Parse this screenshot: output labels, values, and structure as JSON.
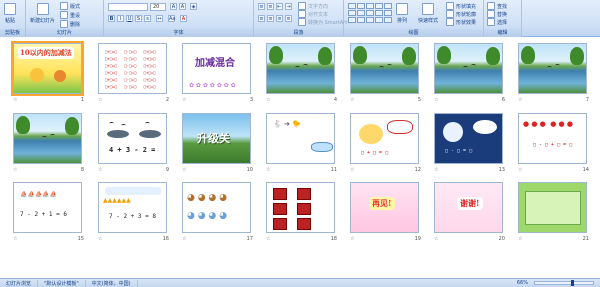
{
  "ribbon": {
    "groups": [
      {
        "id": "clipboard",
        "label": "剪贴板",
        "buttons": [
          "粘贴"
        ]
      },
      {
        "id": "slides",
        "label": "幻灯片",
        "buttons": [
          "新建幻灯片",
          "版式",
          "重设",
          "删除"
        ]
      },
      {
        "id": "font",
        "label": "字体",
        "font_size": "20"
      },
      {
        "id": "paragraph",
        "label": "段落",
        "buttons": [
          "文字方向",
          "对齐文本",
          "转换为 SmartArt"
        ]
      },
      {
        "id": "drawing",
        "label": "绘图",
        "buttons": [
          "排列",
          "快速样式",
          "形状填充",
          "形状轮廓",
          "形状效果"
        ]
      },
      {
        "id": "editing",
        "label": "编辑",
        "buttons": [
          "查找",
          "替换",
          "选择"
        ]
      }
    ]
  },
  "slides": [
    {
      "n": "1",
      "title": "10以内的加减法",
      "kind": "title"
    },
    {
      "n": "2",
      "kind": "equations"
    },
    {
      "n": "3",
      "title": "加减混合",
      "kind": "heading"
    },
    {
      "n": "4",
      "kind": "lake"
    },
    {
      "n": "5",
      "kind": "lake"
    },
    {
      "n": "6",
      "kind": "lake"
    },
    {
      "n": "7",
      "kind": "lake"
    },
    {
      "n": "8",
      "kind": "lake"
    },
    {
      "n": "9",
      "equation": "4 + 3 - 2 =",
      "kind": "birds"
    },
    {
      "n": "10",
      "title": "升级关",
      "kind": "level"
    },
    {
      "n": "11",
      "kind": "animals"
    },
    {
      "n": "12",
      "kind": "bowl"
    },
    {
      "n": "13",
      "kind": "apples_dark"
    },
    {
      "n": "14",
      "kind": "apples"
    },
    {
      "n": "15",
      "equation": "7 - 2 + 1 = 6",
      "kind": "boats"
    },
    {
      "n": "16",
      "equation": "7 - 2 + 3 = 8",
      "kind": "ducks"
    },
    {
      "n": "17",
      "kind": "bears"
    },
    {
      "n": "18",
      "kind": "cards"
    },
    {
      "n": "19",
      "title": "再见!",
      "kind": "bye"
    },
    {
      "n": "20",
      "title": "谢谢!",
      "kind": "thanks"
    },
    {
      "n": "21",
      "kind": "green"
    }
  ],
  "status": {
    "view": "幻灯片浏览",
    "theme": "\"默认设计模板\"",
    "language": "中文(简体，中国)",
    "zoom": "66%"
  }
}
